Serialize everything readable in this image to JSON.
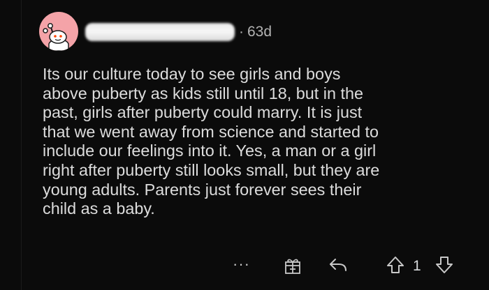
{
  "comment": {
    "separator": "·",
    "age": "63d",
    "body_lines": [
      "Its our culture today to see girls and boys",
      "above puberty as kids still until 18, but in the",
      "past, girls after puberty could marry. It is just",
      "that we went away from science and started to",
      "include our feelings into it. Yes, a man or a girl",
      "right after puberty still looks small, but they are",
      "young adults. Parents just forever sees their",
      "child as a baby."
    ]
  },
  "actions": {
    "more_label": "···",
    "vote_count": "1"
  },
  "icons": {
    "avatar": "reddit-snoo-avatar-icon",
    "more": "ellipsis-icon",
    "award": "gift-award-icon",
    "reply": "reply-arrow-icon",
    "upvote": "upvote-arrow-icon",
    "downvote": "downvote-arrow-icon"
  },
  "colors": {
    "background": "#0b0b0b",
    "text": "#dcdcdc",
    "meta": "#b3b3b3",
    "avatar_bg": "#f4a3a8"
  }
}
